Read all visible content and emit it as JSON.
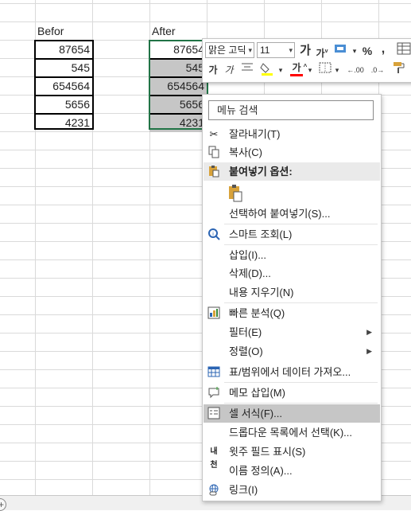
{
  "sheet": {
    "col_a_header": "Befor",
    "col_b_header": "After",
    "col_a_values": [
      "87654",
      "545",
      "654564",
      "5656",
      "4231"
    ],
    "col_b_values": [
      "87654",
      "545",
      "654564",
      "5656",
      "4231"
    ]
  },
  "mini_toolbar": {
    "font_name": "맑은 고딕",
    "font_size": "11",
    "grow_font": "가",
    "shrink_font": "가",
    "bold": "가",
    "italic": "가",
    "font_color_glyph": "가",
    "percent": "%",
    "comma": ",",
    "dec_inc": ".00",
    "dec_dec": ".0",
    "colors": {
      "highlight": "#ffff00",
      "font": "#ff0000"
    }
  },
  "context_menu": {
    "search_label": "메뉴 검색",
    "items": {
      "cut": "잘라내기(T)",
      "copy": "복사(C)",
      "paste_options": "붙여넣기 옵션:",
      "paste_special": "선택하여 붙여넣기(S)...",
      "smart_lookup": "스마트 조회(L)",
      "insert": "삽입(I)...",
      "delete": "삭제(D)...",
      "clear_contents": "내용 지우기(N)",
      "quick_analysis": "빠른 분석(Q)",
      "filter": "필터(E)",
      "sort": "정렬(O)",
      "get_data": "표/범위에서 데이터 가져오...",
      "insert_comment": "메모 삽입(M)",
      "format_cells": "셀 서식(F)...",
      "pick_dropdown": "드롭다운 목록에서 선택(K)...",
      "phonetic": "윗주 필드 표시(S)",
      "define_name": "이름 정의(A)...",
      "link": "링크(I)"
    }
  },
  "accent_colors": {
    "selection": "#217346",
    "highlight_row": "#c6c6c6"
  }
}
